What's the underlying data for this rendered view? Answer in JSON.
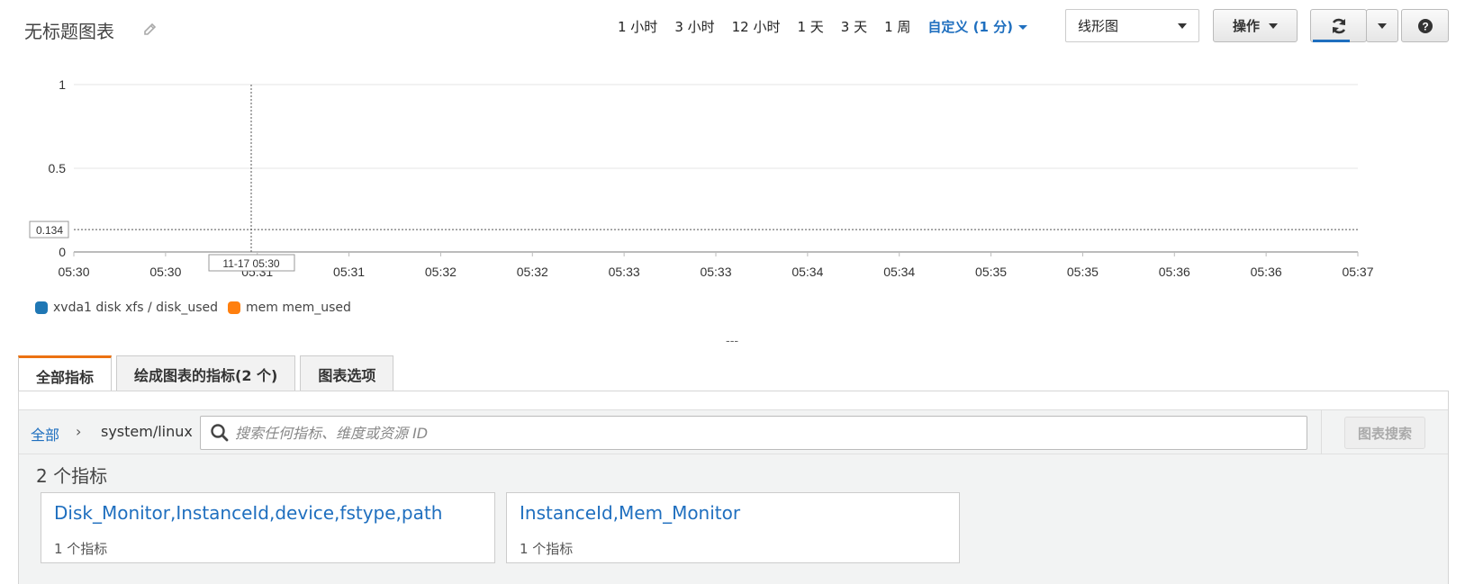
{
  "header": {
    "title": "无标题图表",
    "edit_icon": "pencil-icon",
    "time_ranges": [
      "1 小时",
      "3 小时",
      "12 小时",
      "1 天",
      "3 天",
      "1 周"
    ],
    "custom_range": "自定义 (1 分)",
    "chart_type_select": "线形图",
    "actions_label": "操作",
    "refresh_icon": "refresh-icon",
    "help_icon": "help-icon",
    "accent_color": "#1f6fbf"
  },
  "chart_data": {
    "type": "line",
    "y_ticks": [
      "0",
      "0.5",
      "1"
    ],
    "ylim": [
      0,
      1
    ],
    "x_ticks": [
      "05:30",
      "05:30",
      "05:31",
      "05:31",
      "05:32",
      "05:32",
      "05:33",
      "05:33",
      "05:34",
      "05:34",
      "05:35",
      "05:35",
      "05:36",
      "05:36",
      "05:37"
    ],
    "hover": {
      "x_label": "11-17 05:30",
      "y_value": 0.134,
      "y_label": "0.134"
    },
    "series": [
      {
        "name": "xvda1 disk xfs / disk_used",
        "color": "#1f77b4",
        "values": []
      },
      {
        "name": "mem mem_used",
        "color": "#ff7f0e",
        "values": []
      }
    ],
    "grid": true,
    "legend_position": "bottom-left"
  },
  "resize_handle": "---",
  "tabs": [
    {
      "label": "全部指标",
      "active": true
    },
    {
      "label": "绘成图表的指标(2 个)",
      "active": false
    },
    {
      "label": "图表选项",
      "active": false
    }
  ],
  "browser": {
    "crumb_all": "全部",
    "crumb_sep": "›",
    "namespace": "system/linux",
    "search_placeholder": "搜索任何指标、维度或资源 ID",
    "search_button": "图表搜索",
    "metrics_count": "2 个指标",
    "cards": [
      {
        "title": "Disk_Monitor,InstanceId,device,fstype,path",
        "sub": "1 个指标"
      },
      {
        "title": "InstanceId,Mem_Monitor",
        "sub": "1 个指标"
      }
    ]
  }
}
